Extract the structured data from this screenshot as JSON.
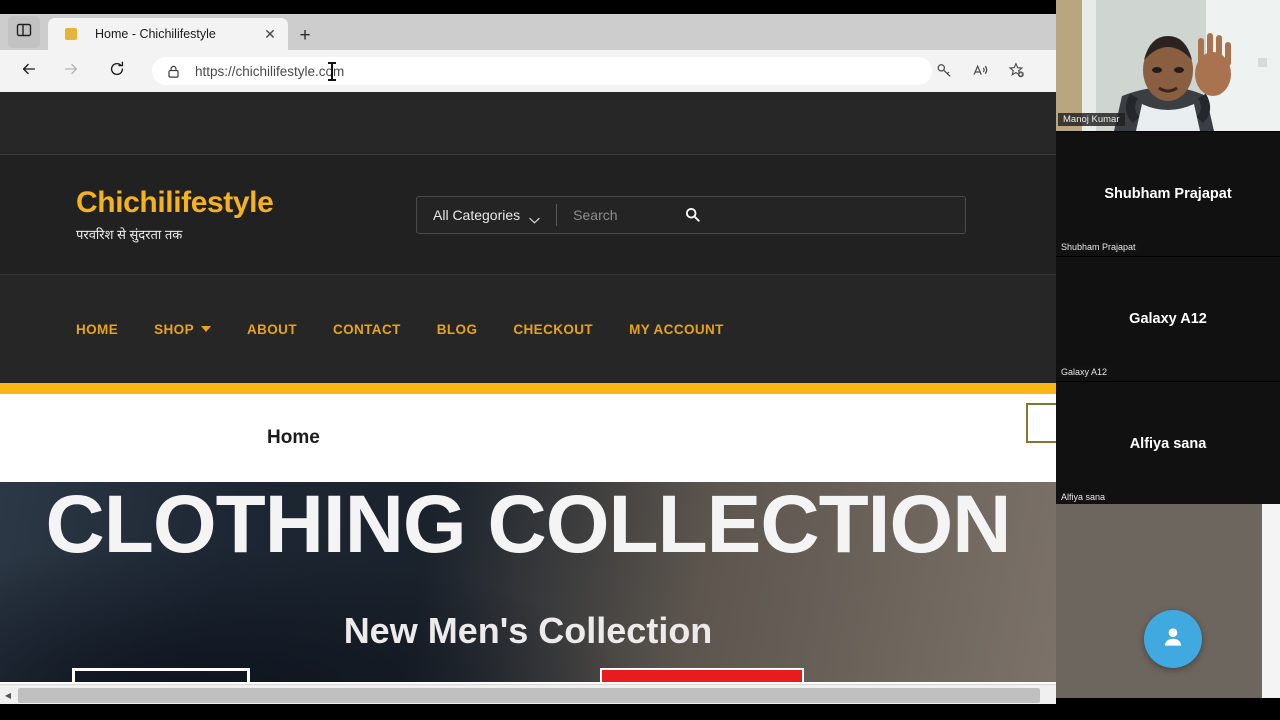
{
  "browser": {
    "tab_actions_icon": "split-pane-icon",
    "tab": {
      "favicon": "site-favicon",
      "title": "Home - Chichilifestyle",
      "close_label": "✕"
    },
    "new_tab_label": "+",
    "back_icon": "arrow-left-icon",
    "forward_icon": "arrow-right-icon",
    "reload_icon": "reload-icon",
    "lock_icon": "lock-icon",
    "url": "https://chichilifestyle.com",
    "toolbar_icons": [
      "key-icon",
      "read-aloud-icon",
      "add-favorite-icon"
    ],
    "scrollbar": {
      "left_arrow": "◀"
    }
  },
  "site": {
    "logo": "Chichilifestyle",
    "tagline": "परवरिश से सुंदरता तक",
    "search": {
      "category_label": "All Categories",
      "chevron_icon": "chevron-down-icon",
      "placeholder": "Search",
      "search_icon": "search-icon"
    },
    "nav": [
      {
        "label": "HOME",
        "has_dropdown": false
      },
      {
        "label": "SHOP",
        "has_dropdown": true
      },
      {
        "label": "ABOUT",
        "has_dropdown": false
      },
      {
        "label": "CONTACT",
        "has_dropdown": false
      },
      {
        "label": "BLOG",
        "has_dropdown": false
      },
      {
        "label": "CHECKOUT",
        "has_dropdown": false
      },
      {
        "label": "MY ACCOUNT",
        "has_dropdown": false
      }
    ],
    "breadcrumb": "Home",
    "hero": {
      "title": "CLOTHING COLLECTION",
      "subtitle": "New Men's Collection"
    },
    "colors": {
      "logo_gold": "#f5b220",
      "nav_gold": "#e8a317",
      "divider_bar": "#fbb615",
      "header_bg": "#212121",
      "cta_red": "#e81c1c"
    }
  },
  "call": {
    "speaker": {
      "name": "Manoj Kumar"
    },
    "participants": [
      {
        "name": "Shubham Prajapat"
      },
      {
        "name": "Galaxy A12"
      },
      {
        "name": "Alfiya sana"
      }
    ],
    "avatar_button_icon": "person-icon",
    "avatar_button_color": "#3fa9e0"
  }
}
